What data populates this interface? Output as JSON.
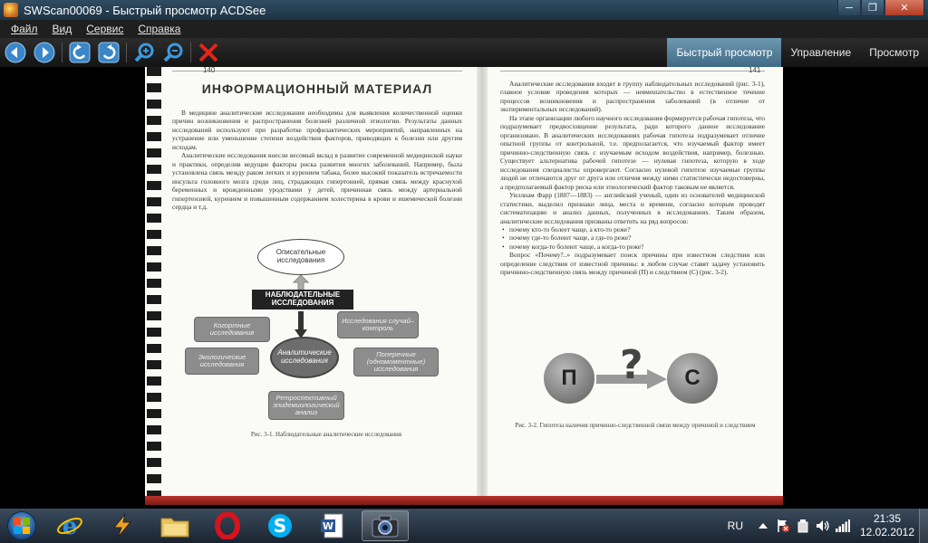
{
  "window": {
    "title": "SWScan00069 - Быстрый просмотр ACDSee",
    "minimize": "─",
    "maximize": "❐",
    "close": "✕"
  },
  "menu": [
    "Файл",
    "Вид",
    "Сервис",
    "Справка"
  ],
  "mode_tabs": {
    "quick": "Быстрый просмотр",
    "manage": "Управление",
    "view": "Просмотр"
  },
  "document": {
    "left_page_number": "140",
    "right_page_number": "141",
    "left_heading": "ИНФОРМАЦИОННЫЙ МАТЕРИАЛ",
    "left_para1": "В медицине аналитические исследования необходимы для выявления количественной оценки причин возникновения и распространения болезней различной этиологии. Результаты данных исследований используют при разработке профилактических мероприятий, направленных на устранение или уменьшение степени воздействия факторов, приводящих к болезни или другим исходам.",
    "left_para2": "Аналитические исследования внесли весомый вклад в развитие современной медицинской науки и практики, определив ведущие факторы риска развития многих заболеваний. Например, была установлена связь между раком легких и курением табака, более высокий показатель встречаемости инсульта головного мозга среди лиц, страдающих гипертонией, прямая связь между краснухой беременных и врожденными уродствами у детей, причинная связь между артериальной гипертензией, курением и повышенным содержанием холестерина в крови и ишемической болезни сердца и т.д.",
    "diagram": {
      "top": "Описательные исследования",
      "bar": "НАБЛЮДАТЕЛЬНЫЕ ИССЛЕДОВАНИЯ",
      "cohort": "Когортные исследования",
      "case_control": "Исследования случай–контроль",
      "center": "Аналитические исследования",
      "ecological": "Экологические исследования",
      "cross": "Поперечные (одномоментные) исследования",
      "retro": "Ретроспективный эпидемиологический анализ"
    },
    "left_caption": "Рис. 3-1. Наблюдательные аналитические исследования",
    "right_para1": "Аналитические исследования входят в группу наблюдательных исследований (рис. 3-1), главное условие проведения которых — невмешательство в естественное течение процессов возникновения и распространения заболеваний (в отличие от экспериментальных исследований).",
    "right_para2": "На этапе организации любого научного исследования формируется рабочая гипотеза, что подразумевает предвосхищение результата, ради которого данное исследование организовано. В аналитических исследованиях рабочая гипотеза подразумевает отличие опытной группы от контрольной, т.е. предполагается, что изучаемый фактор имеет причинно-следственную связь с изучаемым исходом воздействия, например, болезнью. Существует альтернатива рабочей гипотезе — нулевая гипотеза, которую в ходе исследования специалисты опровергают. Согласно нулевой гипотезе изучаемые группы людей не отличаются друг от друга или отличия между ними статистически недостоверны, а предполагаемый фактор риска или этиологический фактор таковым не является.",
    "right_para3": "Уиллиам Фарр (1807—1883) — английский ученый, один из основателей медицинской статистики, выделил признаки лица, места и времени, согласно которым проводят систематизацию и анализ данных, полученных в исследованиях. Таким образом, аналитические исследования призваны ответить на ряд вопросов:",
    "bullets": [
      "почему кто-то болеет чаще, а кто-то реже?",
      "почему где-то болеют чаще, а где-то реже?",
      "почему когда-то болеют чаще, а когда-то реже?"
    ],
    "right_para4": "Вопрос «Почему?..» подразумевает поиск причины при известном следствии или определение следствия от известной причины: в любом случае ставят задачу установить причинно-следственную связь между причиной (П) и следствием (С) (рис. 3-2).",
    "figure_p": "П",
    "figure_q": "?",
    "figure_c": "С",
    "right_caption": "Рис. 3-2. Гипотеза наличия причинно-следственной связи между причиной и следствием"
  },
  "taskbar": {
    "lang": "RU",
    "time": "21:35",
    "date": "12.02.2012"
  },
  "colors": {
    "accent_tab": "#4f7d9a",
    "close_red": "#c0392b"
  }
}
